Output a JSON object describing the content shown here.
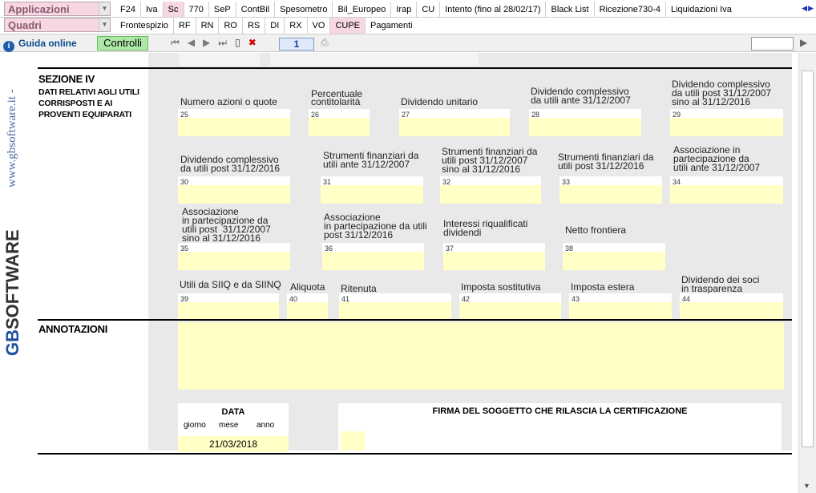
{
  "combos": {
    "applicazioni": "Applicazioni",
    "quadri": "Quadri"
  },
  "tabs_row1": [
    "F24",
    "Iva",
    "Sc",
    "770",
    "SeP",
    "ContBil",
    "Spesometro",
    "Bil_Europeo",
    "Irap",
    "CU",
    "Intento (fino al 28/02/17)",
    "Black List",
    "Ricezione730-4",
    "Liquidazioni Iva"
  ],
  "tabs_row2": [
    "Frontespizio",
    "RF",
    "RN",
    "RO",
    "RS",
    "DI",
    "RX",
    "VO",
    "CUPE",
    "Pagamenti"
  ],
  "toolbar": {
    "guida": "Guida online",
    "controlli": "Controlli",
    "page": "1"
  },
  "logo": {
    "site": "www.gbsoftware.it -",
    "brand_gb": "GB",
    "brand_rest": "SOFTWARE"
  },
  "section": {
    "title": "SEZIONE IV",
    "subtitle": "DATI RELATIVI AGLI UTILI CORRISPOSTI E AI PROVENTI EQUIPARATI",
    "annotazioni": "ANNOTAZIONI"
  },
  "fields": {
    "f25": {
      "label": "Numero azioni o quote",
      "num": "25"
    },
    "f26": {
      "label": "Percentuale\ncontitolarità",
      "num": "26"
    },
    "f27": {
      "label": "Dividendo unitario",
      "num": "27"
    },
    "f28": {
      "label": "Dividendo complessivo\nda utili ante 31/12/2007",
      "num": "28"
    },
    "f29": {
      "label": "Dividendo complessivo\nda utili post 31/12/2007\nsino al 31/12/2016",
      "num": "29"
    },
    "f30": {
      "label": "Dividendo complessivo\nda utili post 31/12/2016",
      "num": "30"
    },
    "f31": {
      "label": "Strumenti finanziari da\nutili ante 31/12/2007",
      "num": "31"
    },
    "f32": {
      "label": "Strumenti finanziari da\nutili post 31/12/2007\nsino al 31/12/2016",
      "num": "32"
    },
    "f33": {
      "label": "Strumenti finanziari da\nutili post 31/12/2016",
      "num": "33"
    },
    "f34": {
      "label": "Associazione in\npartecipazione da\nutili ante 31/12/2007",
      "num": "34"
    },
    "f35": {
      "label": "Associazione\nin partecipazione da\nutili post  31/12/2007\nsino al 31/12/2016",
      "num": "35"
    },
    "f36": {
      "label": "Associazione\nin partecipazione da utili\npost 31/12/2016",
      "num": "36"
    },
    "f37": {
      "label": "Interessi riqualificati\ndividendi",
      "num": "37"
    },
    "f38": {
      "label": "Netto frontiera",
      "num": "38"
    },
    "f39": {
      "label": "Utili da SIIQ e da SIINQ",
      "num": "39"
    },
    "f40": {
      "label": "Aliquota",
      "num": "40"
    },
    "f41": {
      "label": "Ritenuta",
      "num": "41"
    },
    "f42": {
      "label": "Imposta sostitutiva",
      "num": "42"
    },
    "f43": {
      "label": "Imposta estera",
      "num": "43"
    },
    "f44": {
      "label": "Dividendo dei soci\nin trasparenza",
      "num": "44"
    }
  },
  "date": {
    "title": "DATA",
    "giorno": "giorno",
    "mese": "mese",
    "anno": "anno",
    "value": "21/03/2018"
  },
  "firma": {
    "title": "FIRMA DEL SOGGETTO CHE RILASCIA LA CERTIFICAZIONE"
  }
}
